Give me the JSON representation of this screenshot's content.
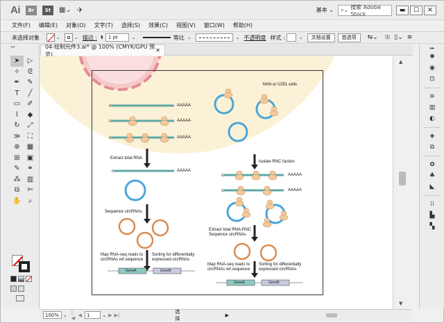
{
  "app": {
    "logo": "Ai"
  },
  "titlebar": {
    "br_icon": "Br",
    "st_icon": "St",
    "workspace": "基本 ⌄",
    "search_placeholder": "搜索 Adobe Stock",
    "minimize": "▬",
    "maximize": "☐",
    "close": "✕"
  },
  "menu": {
    "items": [
      "文件(F)",
      "编辑(E)",
      "对象(O)",
      "文字(T)",
      "选择(S)",
      "效果(C)",
      "视图(V)",
      "窗口(W)",
      "帮助(H)"
    ]
  },
  "controlbar": {
    "selection_label": "未选择对象",
    "stroke_label": "描边 :",
    "stroke_weight": "1 pt",
    "uniform": "等比",
    "opacity_label": "不透明度",
    "style_label": "样式 :",
    "doc_setup": "文档设置",
    "preferences": "首选项"
  },
  "document": {
    "tab_title": "04-绘制元件3.ai* @ 100% (CMYK/GPU 预览)",
    "tab_close": "✕"
  },
  "figure": {
    "cells_label": "NHA or U251 cells",
    "step1": "Extract total RNA",
    "step2": "Sequence circRNAs",
    "step3a": "Map RNA-seq reads to",
    "step3b": "circRNAs ref.sequence",
    "step4a": "Sorting for differentially",
    "step4b": "expressed circRNAs",
    "isolate": "Isolate RNC faction",
    "extract_rnc_a": "Extract total RNA-RNC",
    "extract_rnc_b": "Sequence circRNAs",
    "map2a": "Map RNA-seq reads to",
    "map2b": "circRNAs ref.sequence",
    "sort2a": "Sorting for differentially",
    "sort2b": "expressed circRNAs",
    "polyA": "AAAAA",
    "geneA": "GeneA",
    "geneB": "GeneB"
  },
  "statusbar": {
    "zoom": "100%",
    "page": "1",
    "mode": "选择"
  },
  "colors": {
    "mrna": "#5fa8a6",
    "ribosome": "#f2c99a",
    "circ_blue": "#4aa6d8",
    "circ_orange": "#d98b52",
    "pink": "#f3b6b8",
    "cream": "#fbf1d6"
  }
}
